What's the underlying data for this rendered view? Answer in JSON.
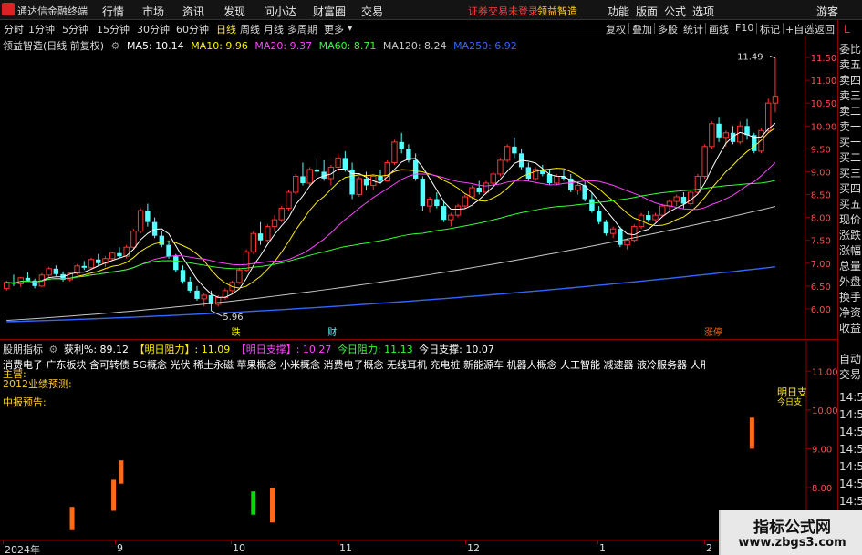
{
  "app": {
    "title": "通达信金融终端",
    "menu": [
      "行情",
      "市场",
      "资讯",
      "发现",
      "问小达",
      "财富圈",
      "交易"
    ],
    "notice_login": "证券交易未登录",
    "notice_product": "领益智造",
    "right_menu": [
      "功能",
      "版面",
      "公式",
      "选项"
    ],
    "user": "游客"
  },
  "toolbar": {
    "periods": [
      "分时",
      "1分钟",
      "5分钟",
      "15分钟",
      "30分钟",
      "60分钟",
      "日线",
      "周线",
      "月线",
      "多周期",
      "更多"
    ],
    "active_period": "日线",
    "more_arrow": "▾",
    "buttons": [
      "复权",
      "叠加",
      "多股",
      "统计",
      "画线",
      "F10",
      "标记",
      "+自选",
      "返回"
    ]
  },
  "right_panel": {
    "mode_letter": "L",
    "items": [
      "委比",
      "卖五",
      "卖四",
      "卖三",
      "卖二",
      "卖一",
      "买一",
      "买二",
      "买三",
      "买四",
      "买五",
      "现价",
      "涨跌",
      "涨幅",
      "总量",
      "外盘",
      "换手",
      "净资",
      "收益"
    ],
    "lower_items": [
      "自动",
      "交易"
    ],
    "times": [
      "14:5",
      "14:5",
      "14:5",
      "14:5",
      "14:5",
      "14:5",
      "14:5",
      "14:5",
      "14:5"
    ]
  },
  "legend": {
    "stock": "领益智造(日线 前复权)",
    "ma5": "MA5: 10.14",
    "ma10": "MA10: 9.96",
    "ma20": "MA20: 9.37",
    "ma60": "MA60: 8.71",
    "ma120": "MA120: 8.24",
    "ma250": "MA250: 6.92"
  },
  "sub_legend": {
    "name": "股朋指标",
    "profit": "获利%: 89.12",
    "res_tomorrow": "【明日阻力】: 11.09",
    "sup_tomorrow": "【明日支撑】: 10.27",
    "res_today": "今日阻力: 11.13",
    "sup_today": "今日支撑: 10.07"
  },
  "concepts": "消费电子 广东板块 含可转债 5G概念 光伏 稀土永磁 苹果概念 小米概念 消费电子概念 无线耳机 充电桩 新能源车 机器人概念 人工智能 减速器 液冷服务器 人形机器人 折叠屏 AI眼镜",
  "main_business": "主营:",
  "perf_forecast": "2012业绩预测:",
  "mid_report": "中报预告:",
  "markers": {
    "lowest": "5.96",
    "highest": "11.49",
    "fall": "跌",
    "fin": "财",
    "limit": "涨停"
  },
  "sub_labels": {
    "res_side": "明日支",
    "today_side": "今日支"
  },
  "time_axis": [
    "2024年",
    "9",
    "10",
    "11",
    "12",
    "1",
    "2"
  ],
  "watermark": {
    "title": "指标公式网",
    "url": "www.zbgs3.com"
  },
  "chart_data": {
    "type": "candlestick",
    "main": {
      "ylim": [
        5.5,
        11.8
      ],
      "yticks": [
        6.0,
        6.5,
        7.0,
        7.5,
        8.0,
        8.5,
        9.0,
        9.5,
        10.0,
        10.5,
        11.0,
        11.5
      ],
      "candles": [
        [
          6.45,
          6.62,
          6.4,
          6.58
        ],
        [
          6.58,
          6.75,
          6.5,
          6.55
        ],
        [
          6.55,
          6.7,
          6.48,
          6.68
        ],
        [
          6.68,
          6.8,
          6.6,
          6.62
        ],
        [
          6.62,
          6.66,
          6.45,
          6.5
        ],
        [
          6.5,
          6.78,
          6.48,
          6.74
        ],
        [
          6.74,
          6.92,
          6.7,
          6.88
        ],
        [
          6.88,
          6.95,
          6.72,
          6.76
        ],
        [
          6.76,
          6.82,
          6.6,
          6.64
        ],
        [
          6.64,
          6.8,
          6.6,
          6.78
        ],
        [
          6.78,
          6.98,
          6.75,
          6.94
        ],
        [
          6.94,
          7.05,
          6.85,
          6.9
        ],
        [
          6.9,
          7.12,
          6.88,
          7.08
        ],
        [
          7.08,
          7.2,
          6.95,
          7.0
        ],
        [
          7.0,
          7.15,
          6.92,
          7.1
        ],
        [
          7.1,
          7.25,
          7.05,
          7.22
        ],
        [
          7.22,
          7.35,
          7.1,
          7.15
        ],
        [
          7.15,
          7.4,
          7.1,
          7.35
        ],
        [
          7.35,
          7.75,
          7.3,
          7.7
        ],
        [
          7.7,
          8.2,
          7.65,
          8.15
        ],
        [
          8.15,
          8.3,
          7.8,
          7.9
        ],
        [
          7.9,
          8.0,
          7.55,
          7.6
        ],
        [
          7.6,
          7.7,
          7.35,
          7.4
        ],
        [
          7.4,
          7.5,
          7.1,
          7.15
        ],
        [
          7.15,
          7.2,
          6.8,
          6.85
        ],
        [
          6.85,
          6.95,
          6.55,
          6.6
        ],
        [
          6.6,
          6.7,
          6.35,
          6.4
        ],
        [
          6.4,
          6.5,
          6.18,
          6.22
        ],
        [
          6.22,
          6.35,
          6.05,
          6.3
        ],
        [
          6.3,
          6.4,
          5.96,
          6.1
        ],
        [
          6.1,
          6.3,
          6.05,
          6.25
        ],
        [
          6.25,
          6.45,
          6.2,
          6.4
        ],
        [
          6.4,
          6.62,
          6.35,
          6.58
        ],
        [
          6.58,
          6.9,
          6.55,
          6.85
        ],
        [
          6.85,
          7.3,
          6.8,
          7.25
        ],
        [
          7.25,
          7.7,
          7.2,
          7.65
        ],
        [
          7.65,
          7.9,
          7.4,
          7.5
        ],
        [
          7.5,
          7.85,
          7.45,
          7.8
        ],
        [
          7.8,
          8.05,
          7.7,
          7.95
        ],
        [
          7.95,
          8.25,
          7.9,
          8.2
        ],
        [
          8.2,
          8.6,
          8.15,
          8.55
        ],
        [
          8.55,
          8.95,
          8.5,
          8.9
        ],
        [
          8.9,
          9.2,
          8.7,
          8.75
        ],
        [
          8.75,
          9.1,
          8.7,
          9.05
        ],
        [
          9.05,
          9.3,
          8.9,
          9.0
        ],
        [
          9.0,
          9.25,
          8.8,
          8.85
        ],
        [
          8.85,
          9.15,
          8.7,
          9.1
        ],
        [
          9.1,
          9.4,
          9.0,
          9.3
        ],
        [
          9.3,
          9.45,
          9.0,
          9.05
        ],
        [
          9.05,
          9.2,
          8.4,
          8.5
        ],
        [
          8.5,
          8.9,
          8.45,
          8.85
        ],
        [
          8.85,
          9.0,
          8.6,
          8.7
        ],
        [
          8.7,
          8.95,
          8.6,
          8.9
        ],
        [
          8.9,
          9.05,
          8.75,
          8.8
        ],
        [
          8.8,
          9.25,
          8.78,
          9.2
        ],
        [
          9.2,
          9.7,
          9.15,
          9.65
        ],
        [
          9.65,
          9.85,
          9.4,
          9.5
        ],
        [
          9.5,
          9.6,
          9.2,
          9.25
        ],
        [
          9.25,
          9.4,
          8.8,
          8.85
        ],
        [
          8.85,
          8.9,
          8.15,
          8.25
        ],
        [
          8.25,
          8.45,
          8.1,
          8.4
        ],
        [
          8.4,
          8.55,
          8.2,
          8.25
        ],
        [
          8.25,
          8.35,
          7.9,
          7.95
        ],
        [
          7.95,
          8.1,
          7.8,
          8.05
        ],
        [
          8.05,
          8.3,
          8.0,
          8.25
        ],
        [
          8.25,
          8.5,
          8.2,
          8.45
        ],
        [
          8.45,
          8.7,
          8.4,
          8.65
        ],
        [
          8.65,
          8.8,
          8.5,
          8.55
        ],
        [
          8.55,
          8.8,
          8.5,
          8.75
        ],
        [
          8.75,
          9.0,
          8.7,
          8.95
        ],
        [
          8.95,
          9.3,
          8.9,
          9.25
        ],
        [
          9.25,
          9.6,
          9.2,
          9.55
        ],
        [
          9.55,
          9.75,
          9.3,
          9.4
        ],
        [
          9.4,
          9.5,
          9.05,
          9.1
        ],
        [
          9.1,
          9.2,
          8.8,
          8.85
        ],
        [
          8.85,
          9.1,
          8.8,
          9.05
        ],
        [
          9.05,
          9.15,
          8.9,
          8.95
        ],
        [
          8.95,
          9.05,
          8.7,
          8.75
        ],
        [
          8.75,
          8.95,
          8.7,
          8.9
        ],
        [
          8.9,
          9.05,
          8.8,
          8.85
        ],
        [
          8.85,
          8.95,
          8.55,
          8.6
        ],
        [
          8.6,
          8.75,
          8.5,
          8.7
        ],
        [
          8.7,
          8.8,
          8.35,
          8.4
        ],
        [
          8.4,
          8.55,
          8.1,
          8.15
        ],
        [
          8.15,
          8.25,
          7.85,
          7.9
        ],
        [
          7.9,
          7.95,
          7.6,
          7.65
        ],
        [
          7.65,
          7.8,
          7.55,
          7.75
        ],
        [
          7.75,
          7.8,
          7.35,
          7.4
        ],
        [
          7.4,
          7.55,
          7.3,
          7.5
        ],
        [
          7.5,
          7.85,
          7.45,
          7.8
        ],
        [
          7.8,
          8.1,
          7.75,
          8.05
        ],
        [
          8.05,
          8.15,
          7.9,
          7.95
        ],
        [
          7.95,
          8.1,
          7.9,
          8.05
        ],
        [
          8.05,
          8.3,
          8.0,
          8.25
        ],
        [
          8.25,
          8.4,
          8.15,
          8.35
        ],
        [
          8.35,
          8.5,
          8.25,
          8.45
        ],
        [
          8.45,
          8.55,
          8.2,
          8.3
        ],
        [
          8.3,
          8.6,
          8.25,
          8.55
        ],
        [
          8.55,
          8.95,
          8.5,
          8.9
        ],
        [
          8.9,
          9.6,
          8.85,
          9.55
        ],
        [
          9.55,
          10.1,
          9.5,
          10.05
        ],
        [
          10.05,
          10.2,
          9.65,
          9.75
        ],
        [
          9.75,
          9.9,
          9.55,
          9.85
        ],
        [
          9.85,
          10.0,
          9.6,
          9.65
        ],
        [
          9.65,
          10.1,
          9.6,
          10.0
        ],
        [
          10.0,
          10.15,
          9.7,
          9.8
        ],
        [
          9.8,
          9.85,
          9.4,
          9.45
        ],
        [
          9.45,
          9.95,
          9.4,
          9.9
        ],
        [
          9.9,
          10.6,
          9.85,
          10.5
        ],
        [
          10.5,
          11.49,
          10.3,
          10.65
        ]
      ],
      "ma_colors": {
        "ma5": "#ffffff",
        "ma10": "#ffee00",
        "ma20": "#ff44ff",
        "ma60": "#33ff33",
        "ma120": "#c8c8c8",
        "ma250": "#3366ff"
      }
    },
    "sub": {
      "ylim": [
        6.8,
        11.5
      ],
      "yticks": [
        7.0,
        8.0,
        9.0,
        10.0,
        11.0
      ],
      "bars": [
        {
          "i": 18,
          "low": 6.9,
          "high": 7.5,
          "color": "#ff6a1a"
        },
        {
          "i": 29,
          "low": 7.4,
          "high": 8.2,
          "color": "#ff6a1a"
        },
        {
          "i": 31,
          "low": 8.1,
          "high": 8.7,
          "color": "#ff6a1a"
        },
        {
          "i": 66,
          "low": 7.3,
          "high": 7.9,
          "color": "#00dd00"
        },
        {
          "i": 71,
          "low": 7.1,
          "high": 8.0,
          "color": "#ff6a1a"
        },
        {
          "i": 198,
          "low": 9.0,
          "high": 9.8,
          "color": "#ff6a1a"
        }
      ]
    }
  }
}
